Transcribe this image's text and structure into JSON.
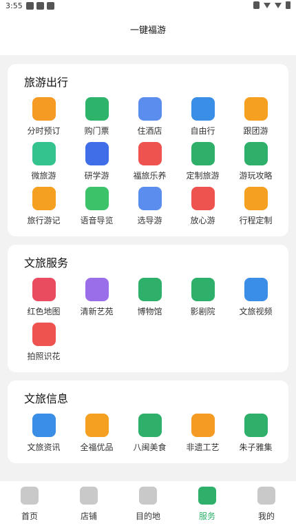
{
  "status": {
    "time": "3:55"
  },
  "header": {
    "title": "一键福游"
  },
  "sections": [
    {
      "title": "旅游出行",
      "items": [
        {
          "label": "分时预订",
          "icon": "clock-icon",
          "color": "#f59a23"
        },
        {
          "label": "购门票",
          "icon": "ticket-icon",
          "color": "#2db36a"
        },
        {
          "label": "住酒店",
          "icon": "hotel-icon",
          "color": "#5b8def"
        },
        {
          "label": "自由行",
          "icon": "luggage-icon",
          "color": "#3a8ee6"
        },
        {
          "label": "跟团游",
          "icon": "flag-icon",
          "color": "#f5a020"
        },
        {
          "label": "微旅游",
          "icon": "mountain-icon",
          "color": "#34c38f"
        },
        {
          "label": "研学游",
          "icon": "graduation-cap-icon",
          "color": "#3f6ee8"
        },
        {
          "label": "福旅乐养",
          "icon": "lotus-icon",
          "color": "#ef5350"
        },
        {
          "label": "定制旅游",
          "icon": "ruler-icon",
          "color": "#2eb06a"
        },
        {
          "label": "游玩攻略",
          "icon": "guidebook-icon",
          "color": "#2eb06a"
        },
        {
          "label": "旅行游记",
          "icon": "map-icon",
          "color": "#f5a020"
        },
        {
          "label": "语音导览",
          "icon": "speaker-icon",
          "color": "#3cc36a"
        },
        {
          "label": "选导游",
          "icon": "guide-person-icon",
          "color": "#5b8def"
        },
        {
          "label": "放心游",
          "icon": "heart-icon",
          "color": "#ef5350"
        },
        {
          "label": "行程定制",
          "icon": "chat-flag-icon",
          "color": "#f5a020"
        }
      ]
    },
    {
      "title": "文旅服务",
      "items": [
        {
          "label": "红色地图",
          "icon": "star-icon",
          "color": "#e94b5f"
        },
        {
          "label": "清新艺苑",
          "icon": "portrait-icon",
          "color": "#9a6ee8"
        },
        {
          "label": "博物馆",
          "icon": "museum-icon",
          "color": "#2eb06a"
        },
        {
          "label": "影剧院",
          "icon": "camera-icon",
          "color": "#2eb06a"
        },
        {
          "label": "文旅视频",
          "icon": "clapper-icon",
          "color": "#3a8ee6"
        },
        {
          "label": "拍照识花",
          "icon": "scan-flower-icon",
          "color": "#ef5350"
        }
      ]
    },
    {
      "title": "文旅信息",
      "items": [
        {
          "label": "文旅资讯",
          "icon": "news-icon",
          "color": "#3a8ee6"
        },
        {
          "label": "全福优品",
          "icon": "shopping-bag-icon",
          "color": "#f5a020"
        },
        {
          "label": "八闽美食",
          "icon": "bowl-icon",
          "color": "#2eb06a"
        },
        {
          "label": "非遗工艺",
          "icon": "fan-icon",
          "color": "#f59a23"
        },
        {
          "label": "朱子雅集",
          "icon": "book-icon",
          "color": "#2eb06a"
        }
      ]
    }
  ],
  "tabbar": {
    "tabs": [
      {
        "label": "首页",
        "icon": "home-icon"
      },
      {
        "label": "店铺",
        "icon": "store-icon"
      },
      {
        "label": "目的地",
        "icon": "destination-icon"
      },
      {
        "label": "服务",
        "icon": "services-icon",
        "active": true
      },
      {
        "label": "我的",
        "icon": "profile-icon"
      }
    ]
  }
}
